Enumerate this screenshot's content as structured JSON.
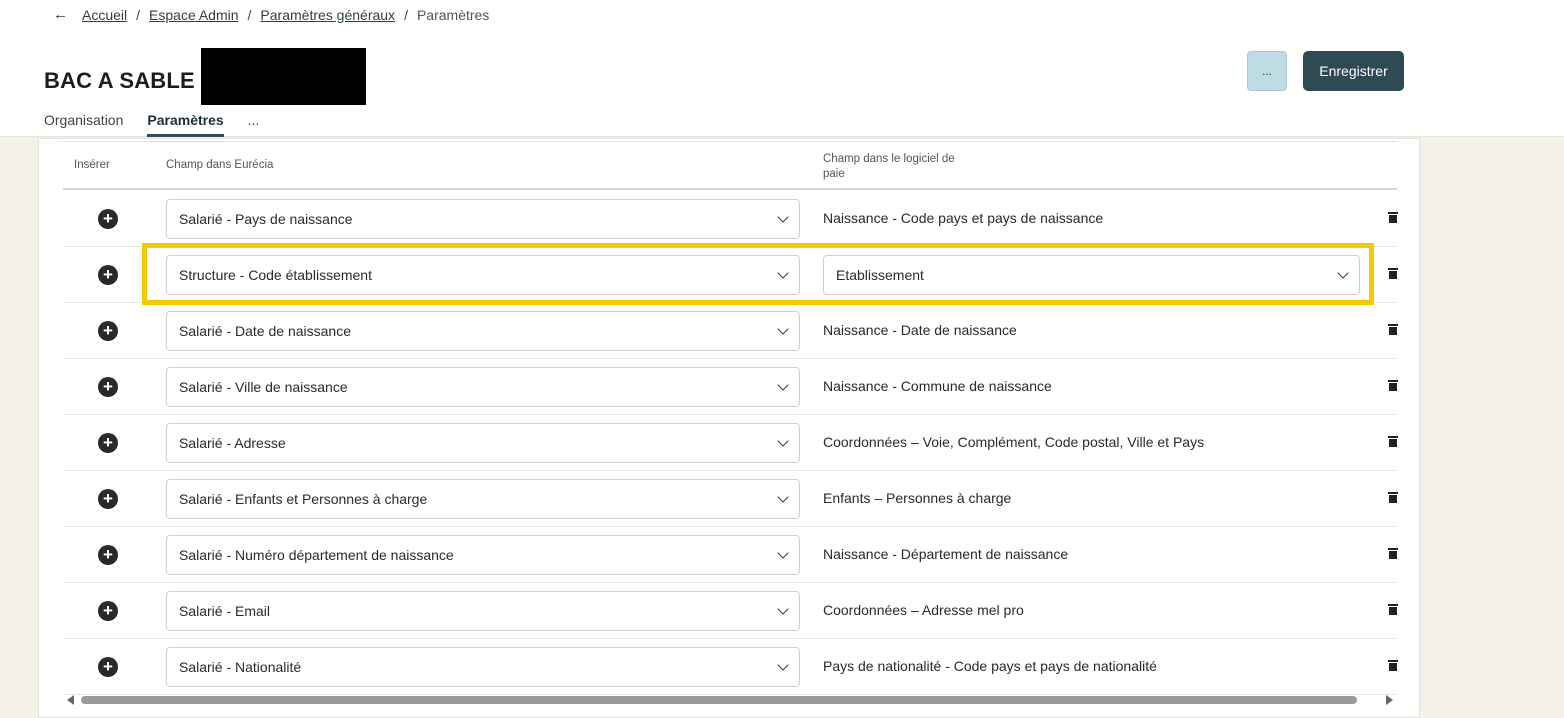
{
  "breadcrumb": {
    "back_icon": "arrow-left-icon",
    "items": [
      "Accueil",
      "Espace Admin",
      "Paramètres généraux"
    ],
    "current": "Paramètres",
    "separator": "/"
  },
  "header": {
    "title": "BAC A SABLE",
    "more_button": "...",
    "save_button": "Enregistrer"
  },
  "tabs": [
    "Organisation",
    "Paramètres",
    "..."
  ],
  "active_tab": "Paramètres",
  "table": {
    "headers": {
      "insert": "Insérer",
      "eurecia": "Champ dans Eurécia",
      "paie": "Champ dans le logiciel de paie"
    },
    "rows": [
      {
        "eurecia": "Salarié - Pays de naissance",
        "paie": "Naissance - Code pays et pays de naissance"
      },
      {
        "eurecia": "Structure - Code établissement",
        "paie": "Etablissement"
      },
      {
        "eurecia": "Salarié - Date de naissance",
        "paie": "Naissance - Date de naissance"
      },
      {
        "eurecia": "Salarié - Ville de naissance",
        "paie": "Naissance - Commune de naissance"
      },
      {
        "eurecia": "Salarié - Adresse",
        "paie": "Coordonnées – Voie, Complément, Code postal, Ville et Pays"
      },
      {
        "eurecia": "Salarié - Enfants et Personnes à charge",
        "paie": "Enfants – Personnes à charge"
      },
      {
        "eurecia": "Salarié - Numéro département de naissance",
        "paie": "Naissance - Département de naissance"
      },
      {
        "eurecia": "Salarié - Email",
        "paie": "Coordonnées – Adresse mel pro"
      },
      {
        "eurecia": "Salarié - Nationalité",
        "paie": "Pays de nationalité - Code pays et pays de nationalité"
      }
    ]
  },
  "colors": {
    "primary_button": "#2f4a52",
    "secondary_button": "#bfdce4",
    "highlight": "#f4c900",
    "background": "#f4f1ea"
  }
}
